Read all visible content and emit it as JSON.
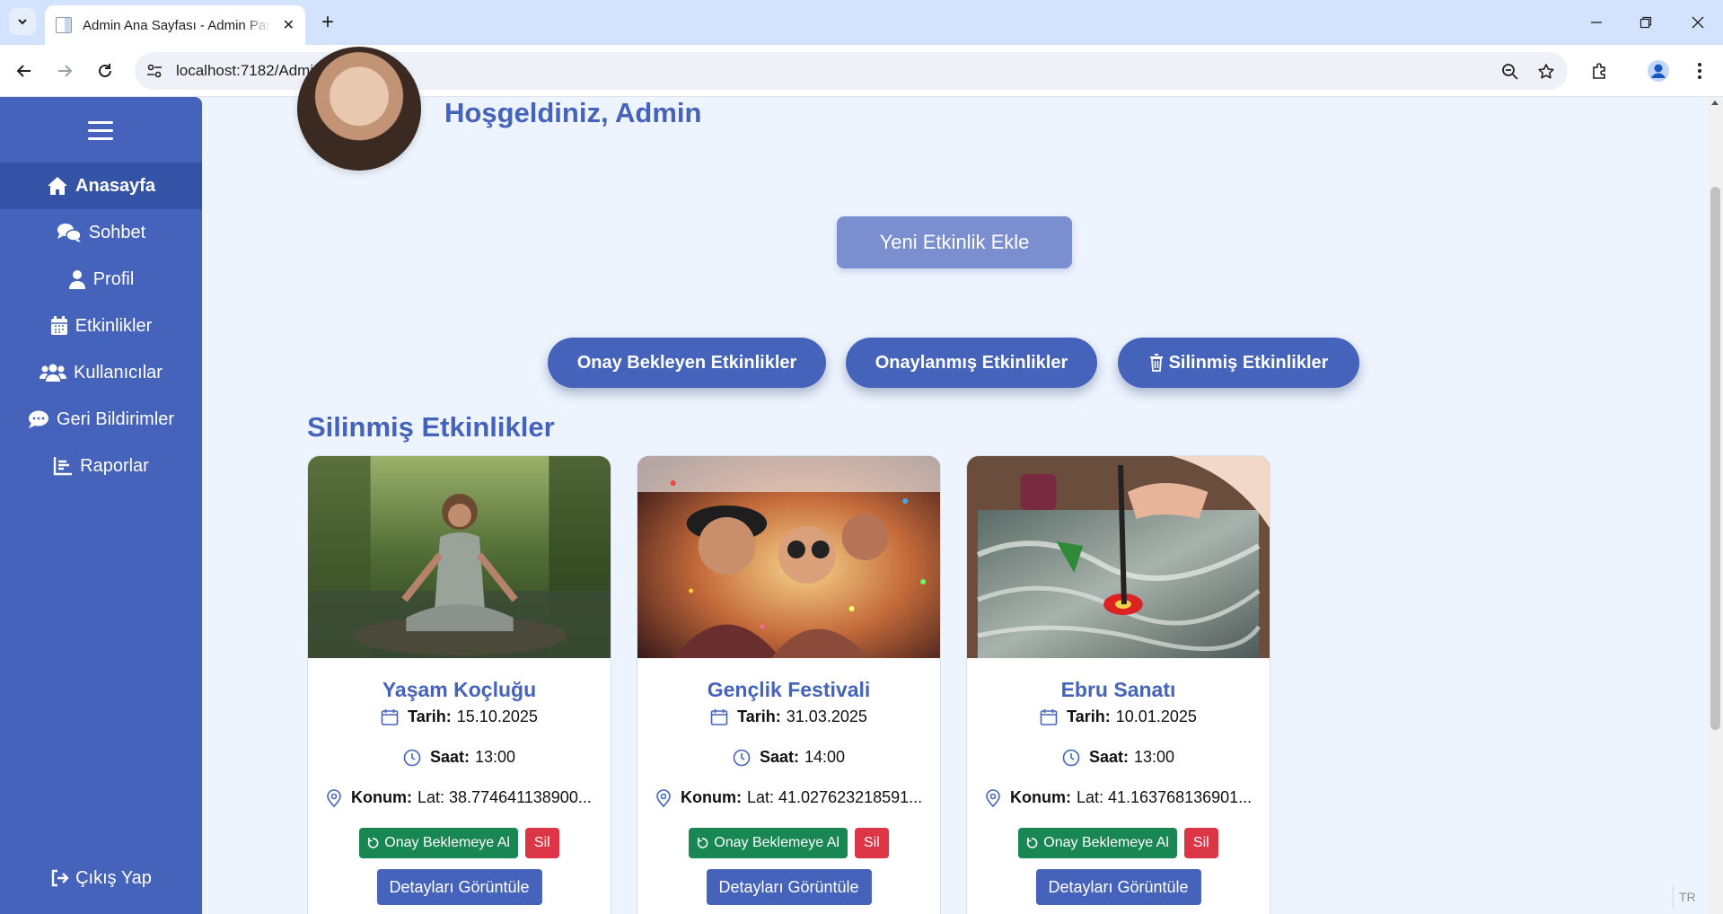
{
  "browser": {
    "tab_title": "Admin Ana Sayfası - Admin Panel",
    "url": "localhost:7182/Admin/AdminIndex"
  },
  "sidebar": {
    "items": [
      {
        "label": "Anasayfa",
        "icon": "home-icon",
        "active": true
      },
      {
        "label": "Sohbet",
        "icon": "chat-icon",
        "active": false
      },
      {
        "label": "Profil",
        "icon": "user-icon",
        "active": false
      },
      {
        "label": "Etkinlikler",
        "icon": "calendar-icon",
        "active": false
      },
      {
        "label": "Kullanıcılar",
        "icon": "users-icon",
        "active": false
      },
      {
        "label": "Geri Bildirimler",
        "icon": "comment-icon",
        "active": false
      },
      {
        "label": "Raporlar",
        "icon": "chart-icon",
        "active": false
      }
    ],
    "logout_label": "Çıkış Yap"
  },
  "header": {
    "welcome": "Hoşgeldiniz, Admin"
  },
  "actions": {
    "add_event": "Yeni Etkinlik Ekle",
    "filters": [
      "Onay Bekleyen Etkinlikler",
      "Onaylanmış Etkinlikler",
      "Silinmiş Etkinlikler"
    ]
  },
  "section_title": "Silinmiş Etkinlikler",
  "labels": {
    "date": "Tarih:",
    "time": "Saat:",
    "location": "Konum:",
    "restore": "Onay Beklemeye Al",
    "delete": "Sil",
    "details": "Detayları Görüntüle"
  },
  "events": [
    {
      "title": "Yaşam Koçluğu",
      "date": "15.10.2025",
      "time": "13:00",
      "location": "Lat: 38.774641138900..."
    },
    {
      "title": "Gençlik Festivali",
      "date": "31.03.2025",
      "time": "14:00",
      "location": "Lat: 41.027623218591..."
    },
    {
      "title": "Ebru Sanatı",
      "date": "10.01.2025",
      "time": "13:00",
      "location": "Lat: 41.163768136901..."
    }
  ],
  "status": {
    "language": "TR"
  },
  "colors": {
    "primary": "#4563ba",
    "sidebar_active": "#3452a6",
    "background": "#edf4fd",
    "success": "#198754",
    "danger": "#dc3545"
  }
}
